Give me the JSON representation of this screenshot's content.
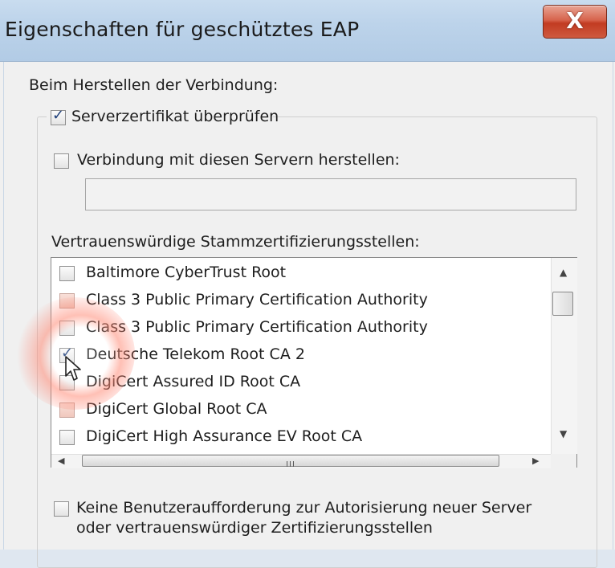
{
  "window": {
    "title": "Eigenschaften für geschütztes EAP",
    "close_glyph": "X"
  },
  "section_label": "Beim Herstellen der Verbindung:",
  "verify_cert": {
    "label": "Serverzertifikat überprüfen",
    "checked": true
  },
  "connect_servers": {
    "label": "Verbindung mit diesen Servern herstellen:",
    "checked": false,
    "value": ""
  },
  "trusted_roots": {
    "label": "Vertrauenswürdige Stammzertifizierungsstellen:",
    "items": [
      {
        "label": "Baltimore CyberTrust Root",
        "checked": false
      },
      {
        "label": "Class 3 Public Primary Certification Authority",
        "checked": false
      },
      {
        "label": "Class 3 Public Primary Certification Authority",
        "checked": false
      },
      {
        "label": "Deutsche Telekom Root CA 2",
        "checked": true
      },
      {
        "label": "DigiCert Assured ID Root CA",
        "checked": false
      },
      {
        "label": "DigiCert Global Root CA",
        "checked": false
      },
      {
        "label": "DigiCert High Assurance EV Root CA",
        "checked": false
      }
    ],
    "hscroll_grip": "III"
  },
  "no_prompt": {
    "label_line1": "Keine Benutzeraufforderung zur Autorisierung neuer Server",
    "label_line2": "oder vertrauenswürdiger Zertifizierungsstellen",
    "checked": false
  },
  "colors": {
    "titlebar": "#bcd3ea",
    "close": "#c23b22",
    "highlight": "#ff8c78"
  }
}
